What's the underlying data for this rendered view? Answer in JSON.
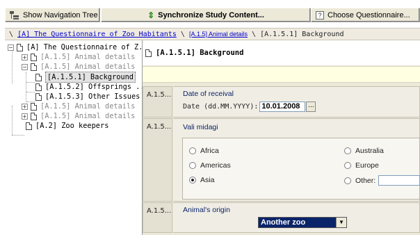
{
  "toolbar": {
    "nav_tree_label": "Show Navigation Tree",
    "sync_label": "Synchronize Study Content...",
    "choose_label": "Choose Questionnaire..."
  },
  "breadcrumb": {
    "sep": "\\",
    "crumbs": [
      {
        "text": "[A] The Questionnaire of Zoo Habitants",
        "link": true
      },
      {
        "text": "[A.1.5] Animal details",
        "link": true
      },
      {
        "text": "[A.1.5.1] Background",
        "link": false
      }
    ]
  },
  "tree": {
    "nodes": [
      {
        "label": "[A] The Questionnaire of Z...",
        "expander": "−",
        "disabled": false,
        "selected": false
      },
      {
        "label": "[A.1.5] Animal details",
        "expander": "+",
        "disabled": true,
        "selected": false
      },
      {
        "label": "[A.1.5] Animal details",
        "expander": "−",
        "disabled": true,
        "selected": false
      },
      {
        "label": "[A.1.5.1] Background",
        "expander": "",
        "disabled": false,
        "selected": true
      },
      {
        "label": "[A.1.5.2] Offsprings ...",
        "expander": "",
        "disabled": false,
        "selected": false
      },
      {
        "label": "[A.1.5.3] Other Issues",
        "expander": "",
        "disabled": false,
        "selected": false
      },
      {
        "label": "[A.1.5] Animal details",
        "expander": "+",
        "disabled": true,
        "selected": false
      },
      {
        "label": "[A.1.5] Animal details",
        "expander": "+",
        "disabled": true,
        "selected": false
      },
      {
        "label": "[A.2] Zoo keepers",
        "expander": "",
        "disabled": false,
        "selected": false
      }
    ]
  },
  "page": {
    "title": "[A.1.5.1] Background"
  },
  "questions": {
    "q1": {
      "number": "A.1.5...",
      "label": "Date of receival",
      "date_caption": "Date (dd.MM.YYYY):",
      "date_value": "10.01.2008",
      "calendar_button": "..."
    },
    "q2": {
      "number": "A.1.5...",
      "label": "Vali midagi",
      "options": [
        {
          "label": "Africa",
          "selected": false
        },
        {
          "label": "Australia",
          "selected": false
        },
        {
          "label": "Americas",
          "selected": false
        },
        {
          "label": "Europe",
          "selected": false
        },
        {
          "label": "Asia",
          "selected": true
        },
        {
          "label": "Other:",
          "selected": false
        }
      ]
    },
    "q3": {
      "number": "A.1.5...",
      "label": "Animal's origin",
      "select_value": "Another zoo"
    }
  },
  "colors": {
    "link": "#0000cc",
    "selection": "#0a246a",
    "highlight_band": "#ffffe1"
  }
}
